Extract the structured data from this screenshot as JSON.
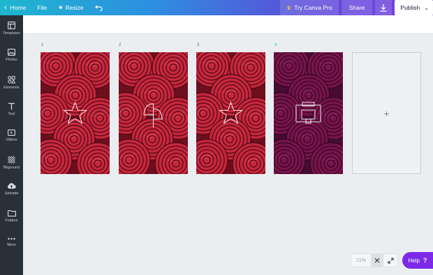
{
  "topbar": {
    "home_label": "Home",
    "file_label": "File",
    "resize_label": "Resize",
    "try_pro_label": "Try Canva Pro",
    "share_label": "Share",
    "publish_label": "Publish"
  },
  "sidebar": {
    "items": [
      {
        "label": "Templates",
        "icon": "templates-icon"
      },
      {
        "label": "Photos",
        "icon": "photos-icon"
      },
      {
        "label": "Elements",
        "icon": "elements-icon"
      },
      {
        "label": "Text",
        "icon": "text-icon"
      },
      {
        "label": "Videos",
        "icon": "videos-icon"
      },
      {
        "label": "Bkground",
        "icon": "background-icon"
      },
      {
        "label": "Uploads",
        "icon": "uploads-icon"
      },
      {
        "label": "Folders",
        "icon": "folders-icon"
      },
      {
        "label": "More",
        "icon": "more-icon"
      }
    ]
  },
  "pages": [
    {
      "number": "1",
      "overlay": "star-outline-icon"
    },
    {
      "number": "2",
      "overlay": "leaf-outline-icon"
    },
    {
      "number": "3",
      "overlay": "star-outline-icon"
    },
    {
      "number": "4",
      "overlay": "camera-frame-icon",
      "active": true
    }
  ],
  "add_page_symbol": "+",
  "zoom": {
    "percent": "21%"
  },
  "help": {
    "label": "Help",
    "symbol": "?"
  },
  "colors": {
    "accent_purple": "#7d2ae8",
    "active_page_number": "#2eb5c9",
    "sidebar_bg": "#293039",
    "rose_red": "#c8283e",
    "rose_magenta": "#8e1850"
  }
}
